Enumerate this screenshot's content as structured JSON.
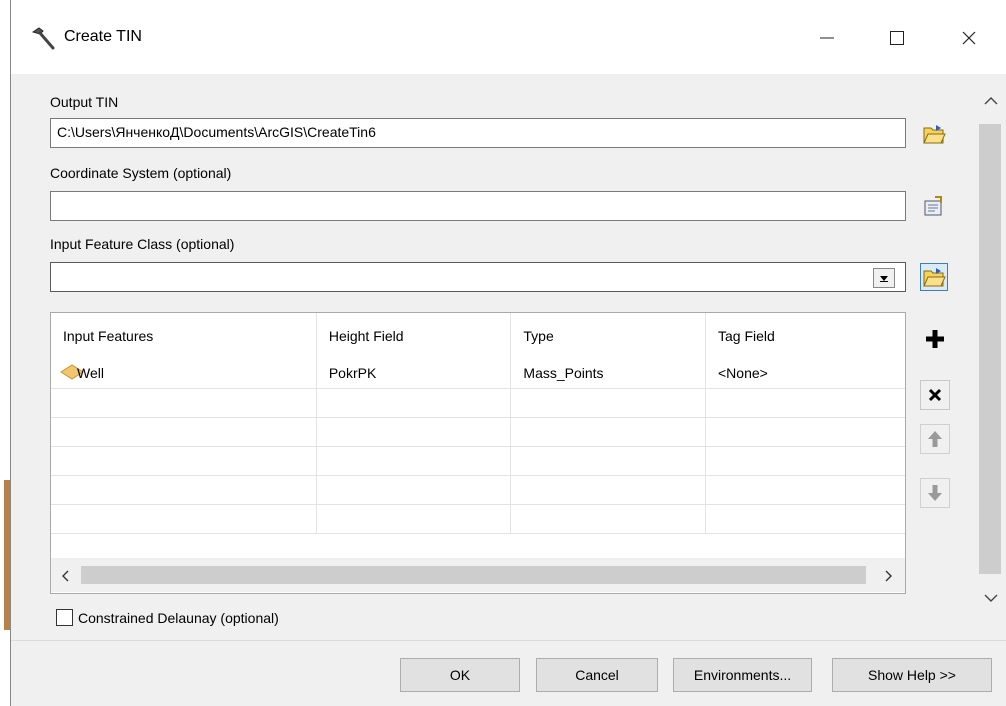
{
  "window": {
    "title": "Create TIN"
  },
  "output_tin": {
    "label": "Output TIN",
    "value": "C:\\Users\\ЯнченкоД\\Documents\\ArcGIS\\CreateTin6"
  },
  "coordinate_system": {
    "label": "Coordinate System (optional)",
    "value": ""
  },
  "input_feature_class": {
    "label": "Input Feature Class (optional)",
    "value": ""
  },
  "table": {
    "headers": [
      "Input Features",
      "Height Field",
      "Type",
      "Tag Field"
    ],
    "rows": [
      {
        "feature": "Well",
        "height_field": "PokrPK",
        "type": "Mass_Points",
        "tag_field": "<None>"
      }
    ]
  },
  "constrained": {
    "label": "Constrained Delaunay (optional)",
    "checked": false
  },
  "buttons": {
    "ok": "OK",
    "cancel": "Cancel",
    "environments": "Environments...",
    "show_help": "Show Help >>"
  },
  "icons": {
    "title": "hammer-icon",
    "browse": "folder-browse-icon",
    "spatial_ref": "spatial-reference-icon",
    "add": "plus-icon",
    "remove": "x-icon",
    "up": "arrow-up-icon",
    "down": "arrow-down-icon",
    "feature": "point-feature-icon"
  }
}
